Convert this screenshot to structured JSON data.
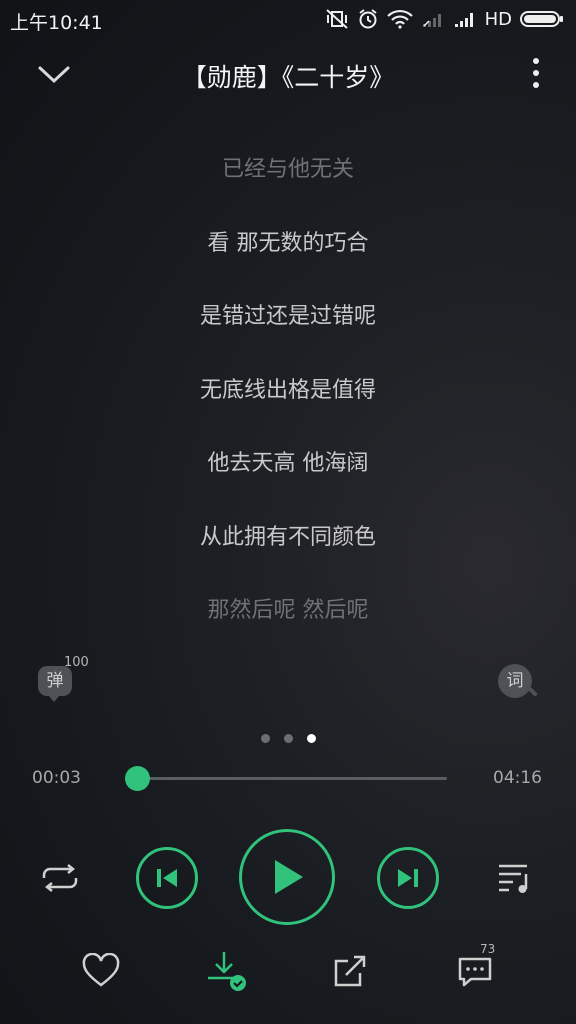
{
  "status": {
    "time": "上午10:41",
    "network": "HD"
  },
  "header": {
    "title": "【勋鹿】《二十岁》"
  },
  "lyrics": [
    {
      "text": "已经与他无关",
      "dim": true
    },
    {
      "text": "看 那无数的巧合",
      "dim": false
    },
    {
      "text": "是错过还是过错呢",
      "dim": false
    },
    {
      "text": "无底线出格是值得",
      "dim": false
    },
    {
      "text": "他去天高 他海阔",
      "dim": false
    },
    {
      "text": "从此拥有不同颜色",
      "dim": false
    },
    {
      "text": "那然后呢 然后呢",
      "dim": true
    }
  ],
  "danmu": {
    "label": "弹",
    "count": "100"
  },
  "lyric_button": {
    "label": "词"
  },
  "pager": {
    "pages": 3,
    "active": 3
  },
  "progress": {
    "current": "00:03",
    "total": "04:16",
    "fraction": 0.012
  },
  "comments": {
    "count": "73"
  },
  "colors": {
    "accent": "#31c27c",
    "text": "#c9c9c9",
    "dim_text": "#6e7176"
  }
}
